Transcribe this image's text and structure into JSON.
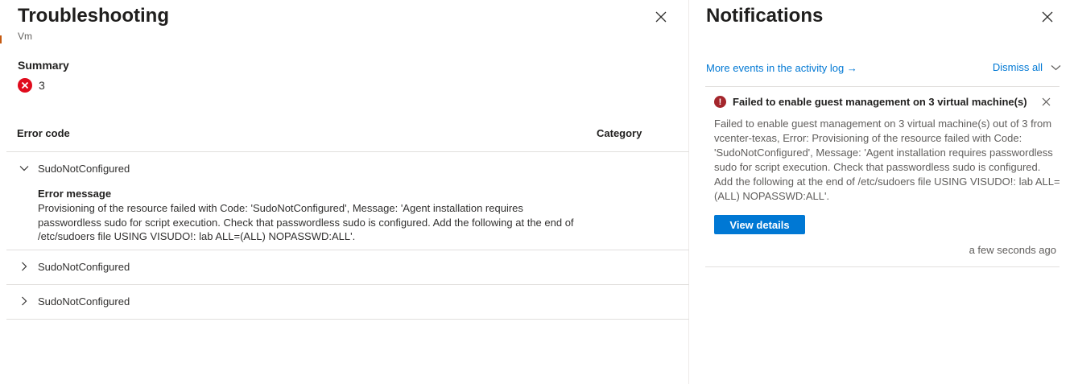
{
  "troubleshooting": {
    "title": "Troubleshooting",
    "subtitle": "Vm",
    "summary_label": "Summary",
    "error_count": "3",
    "columns": {
      "error_code": "Error code",
      "category": "Category"
    },
    "rows": [
      {
        "code": "SudoNotConfigured",
        "expanded": true
      },
      {
        "code": "SudoNotConfigured",
        "expanded": false
      },
      {
        "code": "SudoNotConfigured",
        "expanded": false
      }
    ],
    "error_message_label": "Error message",
    "error_message_text": "Provisioning of the resource failed with Code: 'SudoNotConfigured', Message: 'Agent installation requires passwordless sudo for script execution. Check that passwordless sudo is configured. Add the following at the end of /etc/sudoers file USING VISUDO!: lab ALL=(ALL) NOPASSWD:ALL'."
  },
  "notifications": {
    "title": "Notifications",
    "activity_link": "More events in the activity log →",
    "dismiss_all": "Dismiss all",
    "item": {
      "title": "Failed to enable guest management on 3 virtual machine(s)",
      "body": "Failed to enable guest management on 3 virtual machine(s) out of 3 from vcenter-texas, Error: Provisioning of the resource failed with Code: 'SudoNotConfigured', Message: 'Agent installation requires passwordless sudo for script execution. Check that passwordless sudo is configured. Add the following at the end of /etc/sudoers file USING VISUDO!: lab ALL=(ALL) NOPASSWD:ALL'.",
      "button_label": "View details",
      "timestamp": "a few seconds ago"
    }
  },
  "colors": {
    "accent": "#0078d4",
    "error": "#e00b1c",
    "error_dark": "#a4262c"
  },
  "icons": {
    "close": "close-icon",
    "error": "error-circle-icon",
    "chevron_down": "chevron-down-icon",
    "chevron_right": "chevron-right-icon",
    "warning": "exclamation-circle-icon"
  }
}
